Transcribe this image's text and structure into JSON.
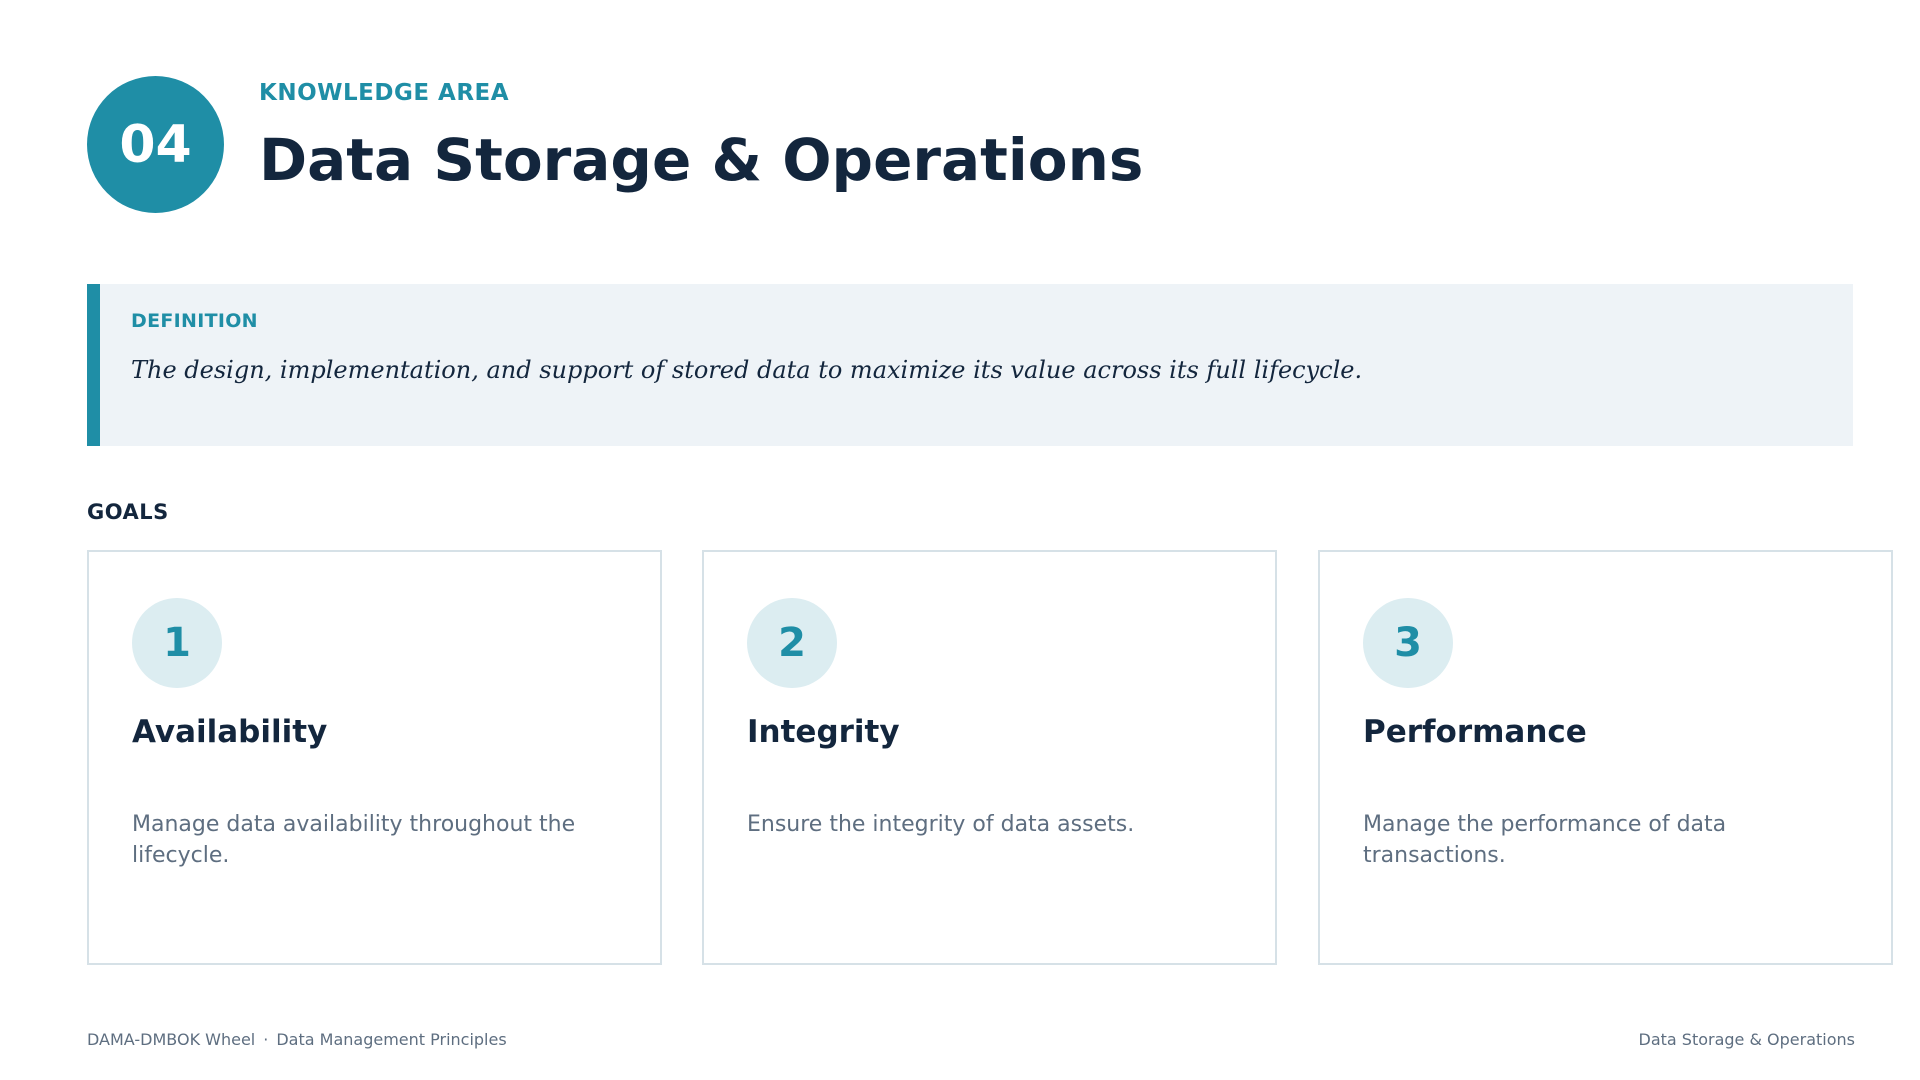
{
  "header": {
    "badge_number": "04",
    "eyebrow": "KNOWLEDGE AREA",
    "title": "Data Storage & Operations"
  },
  "definition": {
    "label": "DEFINITION",
    "text": "The design, implementation, and support of stored data to maximize its value across its full lifecycle."
  },
  "goals": {
    "heading": "GOALS",
    "items": [
      {
        "number": "1",
        "title": "Availability",
        "description": "Manage data availability throughout the lifecycle."
      },
      {
        "number": "2",
        "title": "Integrity",
        "description": "Ensure the integrity of data assets."
      },
      {
        "number": "3",
        "title": "Performance",
        "description": "Manage the performance of data transactions."
      }
    ]
  },
  "footer": {
    "left_primary": "DAMA-DMBOK Wheel",
    "separator": "·",
    "left_secondary": "Data Management Principles",
    "right": "Data Storage & Operations"
  },
  "colors": {
    "accent": "#1f8ea6",
    "heading": "#13263d",
    "muted": "#5e6e80",
    "definition_bg": "#eef3f7",
    "goal_number_bg": "#dcedf1",
    "card_border": "#d6e1e7"
  }
}
